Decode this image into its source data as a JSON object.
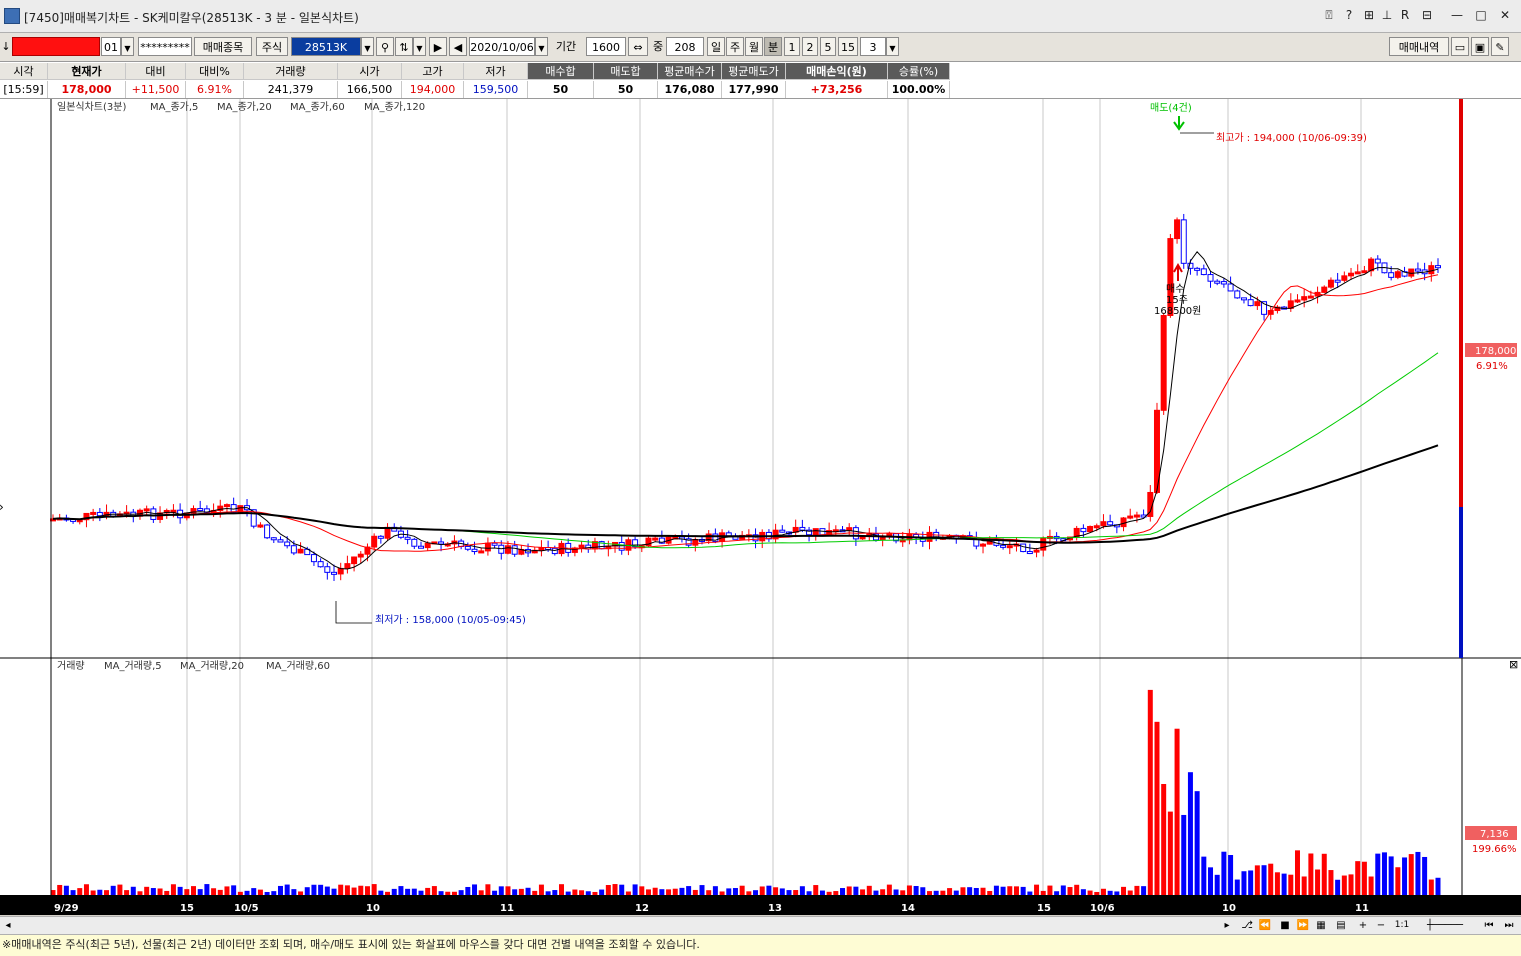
{
  "window": {
    "title": "[7450]매매복기차트 - SK케미칼우(28513K - 3 분 - 일본식차트)",
    "controls": [
      "⍔",
      "?",
      "⊞",
      "⊥",
      "R",
      "⊟",
      "—",
      "□",
      "✕"
    ]
  },
  "toolbar": {
    "account_suffix": "01",
    "password_mask": "*********",
    "trade_item_button": "매매종목",
    "market_label": "주식",
    "code_value": "28513K",
    "date_value": "2020/10/06",
    "period_label": "기간",
    "period_value": "1600",
    "mid_label": "중",
    "mid_value": "208",
    "day_tab": "일",
    "week_tab": "주",
    "month_tab": "월",
    "minute_tab": "분",
    "n1": "1",
    "n2": "2",
    "n5": "5",
    "n15": "15",
    "interval_value": "3",
    "trade_history_button": "매매내역"
  },
  "summary": {
    "headers": [
      "시각",
      "현재가",
      "대비",
      "대비%",
      "거래량",
      "시가",
      "고가",
      "저가",
      "매수합",
      "매도합",
      "평균매수가",
      "평균매도가",
      "매매손익(원)",
      "승률(%)"
    ],
    "values": [
      "[15:59]",
      "178,000",
      "+11,500",
      "6.91%",
      "241,379",
      "166,500",
      "194,000",
      "159,500",
      "50",
      "50",
      "176,080",
      "177,990",
      "+73,256",
      "100.00%"
    ]
  },
  "chart": {
    "legend_price": {
      "name": "일본식차트(3분)",
      "ma": [
        "MA_종가,5",
        "MA_종가,20",
        "MA_종가,60",
        "MA_종가,120"
      ]
    },
    "legend_volume": {
      "name": "거래량",
      "ma": [
        "MA_거래량,5",
        "MA_거래량,20",
        "MA_거래량,60"
      ]
    },
    "sell_marker": "매도(4건)",
    "high_annotation": "최고가 : 194,000 (10/06-09:39)",
    "low_annotation": "최저가 : 158,000 (10/05-09:45)",
    "buy_marker": [
      "매수",
      "15주",
      "168500원"
    ],
    "price_tag": "178,000",
    "price_pct": "6.91%",
    "volume_tag": "7,136",
    "volume_pct": "199.66%",
    "x_labels": [
      "9/29",
      "15",
      "10/5",
      "10",
      "11",
      "12",
      "13",
      "14",
      "15",
      "10/6",
      "10",
      "11"
    ],
    "colors": {
      "up": "#ff0000",
      "down": "#0000ff",
      "ma5": "#000000",
      "ma20": "#ff0000",
      "ma60": "#00cc00",
      "ma120": "#000000"
    }
  },
  "scrollbar": {
    "ratio_label": "1:1"
  },
  "status": {
    "message": "※매매내역은 주식(최근 5년), 선물(최근 2년) 데이터만 조회 되며, 매수/매도 표시에 있는 화살표에 마우스를 갖다 대면 건별 내역을 조회할 수 있습니다."
  }
}
